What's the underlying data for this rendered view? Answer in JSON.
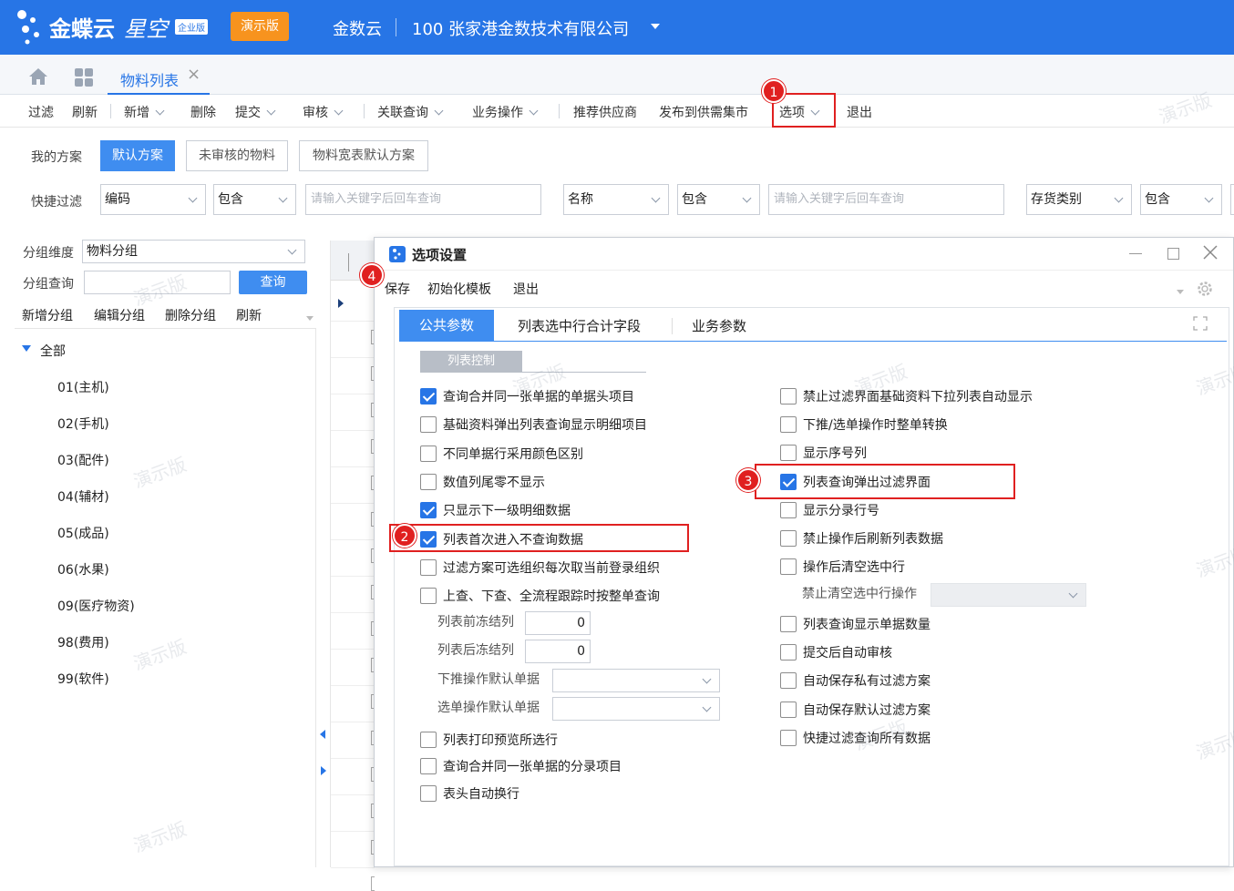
{
  "header": {
    "brand": "金蝶云",
    "product": "星空",
    "edition": "企业版",
    "demo_badge": "演示版",
    "tenant": "金数云",
    "org": "100 张家港金数技术有限公司"
  },
  "tabs": {
    "active_tab": "物料列表",
    "close_symbol": "×"
  },
  "toolbar": {
    "filter": "过滤",
    "refresh": "刷新",
    "add": "新增",
    "delete": "删除",
    "submit": "提交",
    "audit": "审核",
    "related": "关联查询",
    "business": "业务操作",
    "recommend": "推荐供应商",
    "publish": "发布到供需集市",
    "options": "选项",
    "exit": "退出"
  },
  "schemes": {
    "label": "我的方案",
    "default": "默认方案",
    "unaudited": "未审核的物料",
    "wide": "物料宽表默认方案"
  },
  "quickfilter": {
    "label": "快捷过滤",
    "f1_field": "编码",
    "f1_op": "包含",
    "f1_placeholder": "请输入关键字后回车查询",
    "f2_field": "名称",
    "f2_op": "包含",
    "f2_placeholder": "请输入关键字后回车查询",
    "f3_field": "存货类别",
    "f3_op": "包含"
  },
  "group": {
    "dim_label": "分组维度",
    "dim_value": "物料分组",
    "query_label": "分组查询",
    "query_button": "查询",
    "add": "新增分组",
    "edit": "编辑分组",
    "delete": "删除分组",
    "refresh": "刷新"
  },
  "tree": {
    "root": "全部",
    "items": [
      "01(主机)",
      "02(手机)",
      "03(配件)",
      "04(辅材)",
      "05(成品)",
      "06(水果)",
      "09(医疗物资)",
      "98(费用)",
      "99(软件)"
    ]
  },
  "dialog": {
    "title": "选项设置",
    "menu": {
      "save": "保存",
      "init": "初始化模板",
      "exit": "退出"
    },
    "tabs": [
      "公共参数",
      "列表选中行合计字段",
      "业务参数"
    ],
    "section": "列表控制",
    "left": [
      {
        "label": "查询合并同一张单据的单据头项目",
        "checked": true
      },
      {
        "label": "基础资料弹出列表查询显示明细项目",
        "checked": false
      },
      {
        "label": "不同单据行采用颜色区别",
        "checked": false
      },
      {
        "label": "数值列尾零不显示",
        "checked": false
      },
      {
        "label": "只显示下一级明细数据",
        "checked": true
      },
      {
        "label": "列表首次进入不查询数据",
        "checked": true
      },
      {
        "label": "过滤方案可选组织每次取当前登录组织",
        "checked": false
      },
      {
        "label": "上查、下查、全流程跟踪时按整单查询",
        "checked": false
      }
    ],
    "freeze_before_label": "列表前冻结列",
    "freeze_before_value": "0",
    "freeze_after_label": "列表后冻结列",
    "freeze_after_value": "0",
    "push_default_label": "下推操作默认单据",
    "select_default_label": "选单操作默认单据",
    "left2": [
      {
        "label": "列表打印预览所选行",
        "checked": false
      },
      {
        "label": "查询合并同一张单据的分录项目",
        "checked": false
      },
      {
        "label": "表头自动换行",
        "checked": false
      }
    ],
    "right": [
      {
        "label": "禁止过滤界面基础资料下拉列表自动显示",
        "checked": false
      },
      {
        "label": "下推/选单操作时整单转换",
        "checked": false
      },
      {
        "label": "显示序号列",
        "checked": false
      },
      {
        "label": "列表查询弹出过滤界面",
        "checked": true
      },
      {
        "label": "显示分录行号",
        "checked": false
      },
      {
        "label": "禁止操作后刷新列表数据",
        "checked": false
      },
      {
        "label": "操作后清空选中行",
        "checked": false
      }
    ],
    "forbid_clear_label": "禁止清空选中行操作",
    "right2": [
      {
        "label": "列表查询显示单据数量",
        "checked": false
      },
      {
        "label": "提交后自动审核",
        "checked": false
      },
      {
        "label": "自动保存私有过滤方案",
        "checked": false
      },
      {
        "label": "自动保存默认过滤方案",
        "checked": false
      },
      {
        "label": "快捷过滤查询所有数据",
        "checked": false
      }
    ]
  },
  "annotations": [
    "1",
    "2",
    "3",
    "4"
  ],
  "watermark": "演示版"
}
